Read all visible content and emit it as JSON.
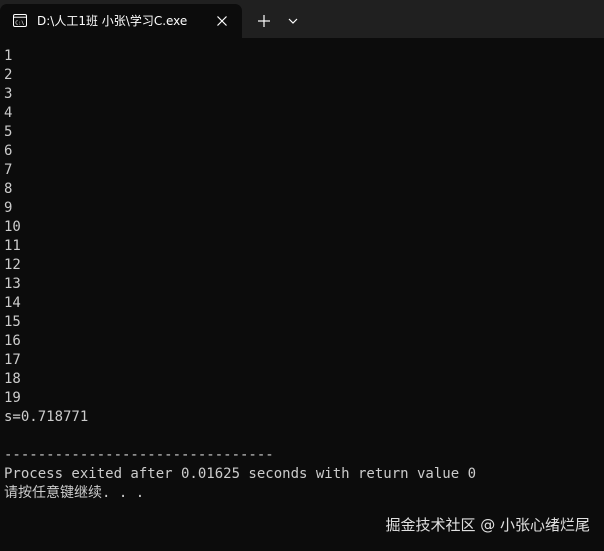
{
  "tab": {
    "title": "D:\\人工1班  小张\\学习C.exe",
    "icon": "terminal-icon"
  },
  "titlebar": {
    "new_tab_icon": "plus-icon",
    "dropdown_icon": "chevron-down-icon",
    "close_icon": "close-icon"
  },
  "console": {
    "lines": [
      "1",
      "2",
      "3",
      "4",
      "5",
      "6",
      "7",
      "8",
      "9",
      "10",
      "11",
      "12",
      "13",
      "14",
      "15",
      "16",
      "17",
      "18",
      "19",
      "s=0.718771",
      "",
      "--------------------------------",
      "Process exited after 0.01625 seconds with return value 0",
      "请按任意键继续. . ."
    ]
  },
  "watermark": "掘金技术社区 @ 小张心绪烂尾",
  "colors": {
    "background": "#0c0c0c",
    "titlebar": "#202020",
    "text": "#cccccc"
  }
}
